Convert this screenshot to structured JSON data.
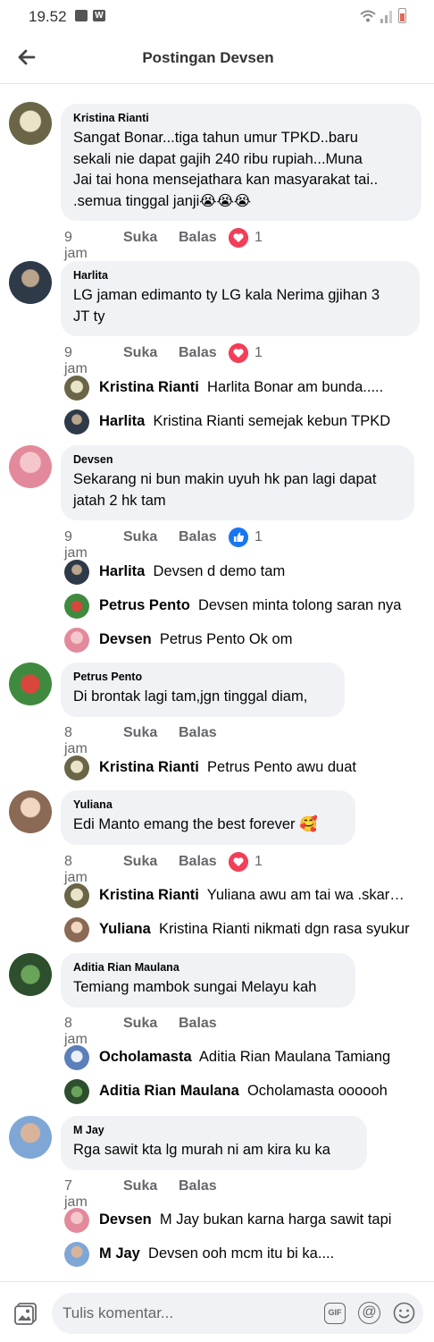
{
  "status_bar": {
    "time": "19.52",
    "w_badge": "W"
  },
  "header": {
    "title": "Postingan Devsen"
  },
  "comments": [
    {
      "author": "Kristina Rianti",
      "text": "Sangat Bonar...tiga tahun umur TPKD..baru\nsekali nie dapat gajih 240 ribu rupiah...Muna\nJai tai hona mensejathara kan masyarakat tai..\n.semua tinggal janji😭😭😭",
      "time": "9 jam",
      "like": "Suka",
      "reply": "Balas",
      "reaction": "love",
      "reaction_count": "1",
      "replies": []
    },
    {
      "author": "Harlita",
      "text": "LG jaman edimanto ty LG kala Nerima gjihan 3\nJT ty",
      "time": "9 jam",
      "like": "Suka",
      "reply": "Balas",
      "reaction": "love",
      "reaction_count": "1",
      "replies": [
        {
          "author": "Kristina Rianti",
          "text": "Harlita Bonar am bunda....."
        },
        {
          "author": "Harlita",
          "text": "Kristina Rianti semejak kebun TPKD"
        }
      ]
    },
    {
      "author": "Devsen",
      "text": "Sekarang ni bun makin uyuh hk pan lagi dapat\njatah 2 hk tam",
      "time": "9 jam",
      "like": "Suka",
      "reply": "Balas",
      "reaction": "like",
      "reaction_count": "1",
      "replies": [
        {
          "author": "Harlita",
          "text": "Devsen d demo tam"
        },
        {
          "author": "Petrus Pento",
          "text": "Devsen minta tolong saran nya"
        },
        {
          "author": "Devsen",
          "text": "Petrus Pento Ok om"
        }
      ]
    },
    {
      "author": "Petrus Pento",
      "text": "Di brontak lagi tam,jgn tinggal diam,",
      "time": "8 jam",
      "like": "Suka",
      "reply": "Balas",
      "reaction": "",
      "reaction_count": "",
      "replies": [
        {
          "author": "Kristina Rianti",
          "text": "Petrus Pento awu duat"
        }
      ]
    },
    {
      "author": "Yuliana",
      "text": "Edi Manto emang the best forever 🥰",
      "time": "8 jam",
      "like": "Suka",
      "reply": "Balas",
      "reaction": "love",
      "reaction_count": "1",
      "replies": [
        {
          "author": "Kristina Rianti",
          "text": "Yuliana awu am tai wa .skarang"
        },
        {
          "author": "Yuliana",
          "text": "Kristina Rianti nikmati dgn rasa syukur"
        }
      ]
    },
    {
      "author": "Aditia Rian Maulana",
      "text": "Temiang mambok sungai Melayu kah",
      "time": "8 jam",
      "like": "Suka",
      "reply": "Balas",
      "reaction": "",
      "reaction_count": "",
      "replies": [
        {
          "author": "Ocholamasta",
          "text": "Aditia Rian Maulana Tamiang"
        },
        {
          "author": "Aditia Rian Maulana",
          "text": "Ocholamasta oooooh"
        }
      ]
    },
    {
      "author": "M Jay",
      "text": "Rga sawit kta lg murah ni am kira ku ka",
      "time": "7 jam",
      "like": "Suka",
      "reply": "Balas",
      "reaction": "",
      "reaction_count": "",
      "replies": [
        {
          "author": "Devsen",
          "text": "M Jay bukan karna harga sawit tapi"
        },
        {
          "author": "M Jay",
          "text": "Devsen ooh mcm itu bi ka...."
        }
      ]
    }
  ],
  "composer": {
    "placeholder": "Tulis komentar...",
    "gif_label": "GIF",
    "at_label": "@"
  },
  "colors": {
    "accent": "#1877f2",
    "love": "#f33e58",
    "bubble": "#f0f2f5",
    "muted": "#65676b"
  }
}
